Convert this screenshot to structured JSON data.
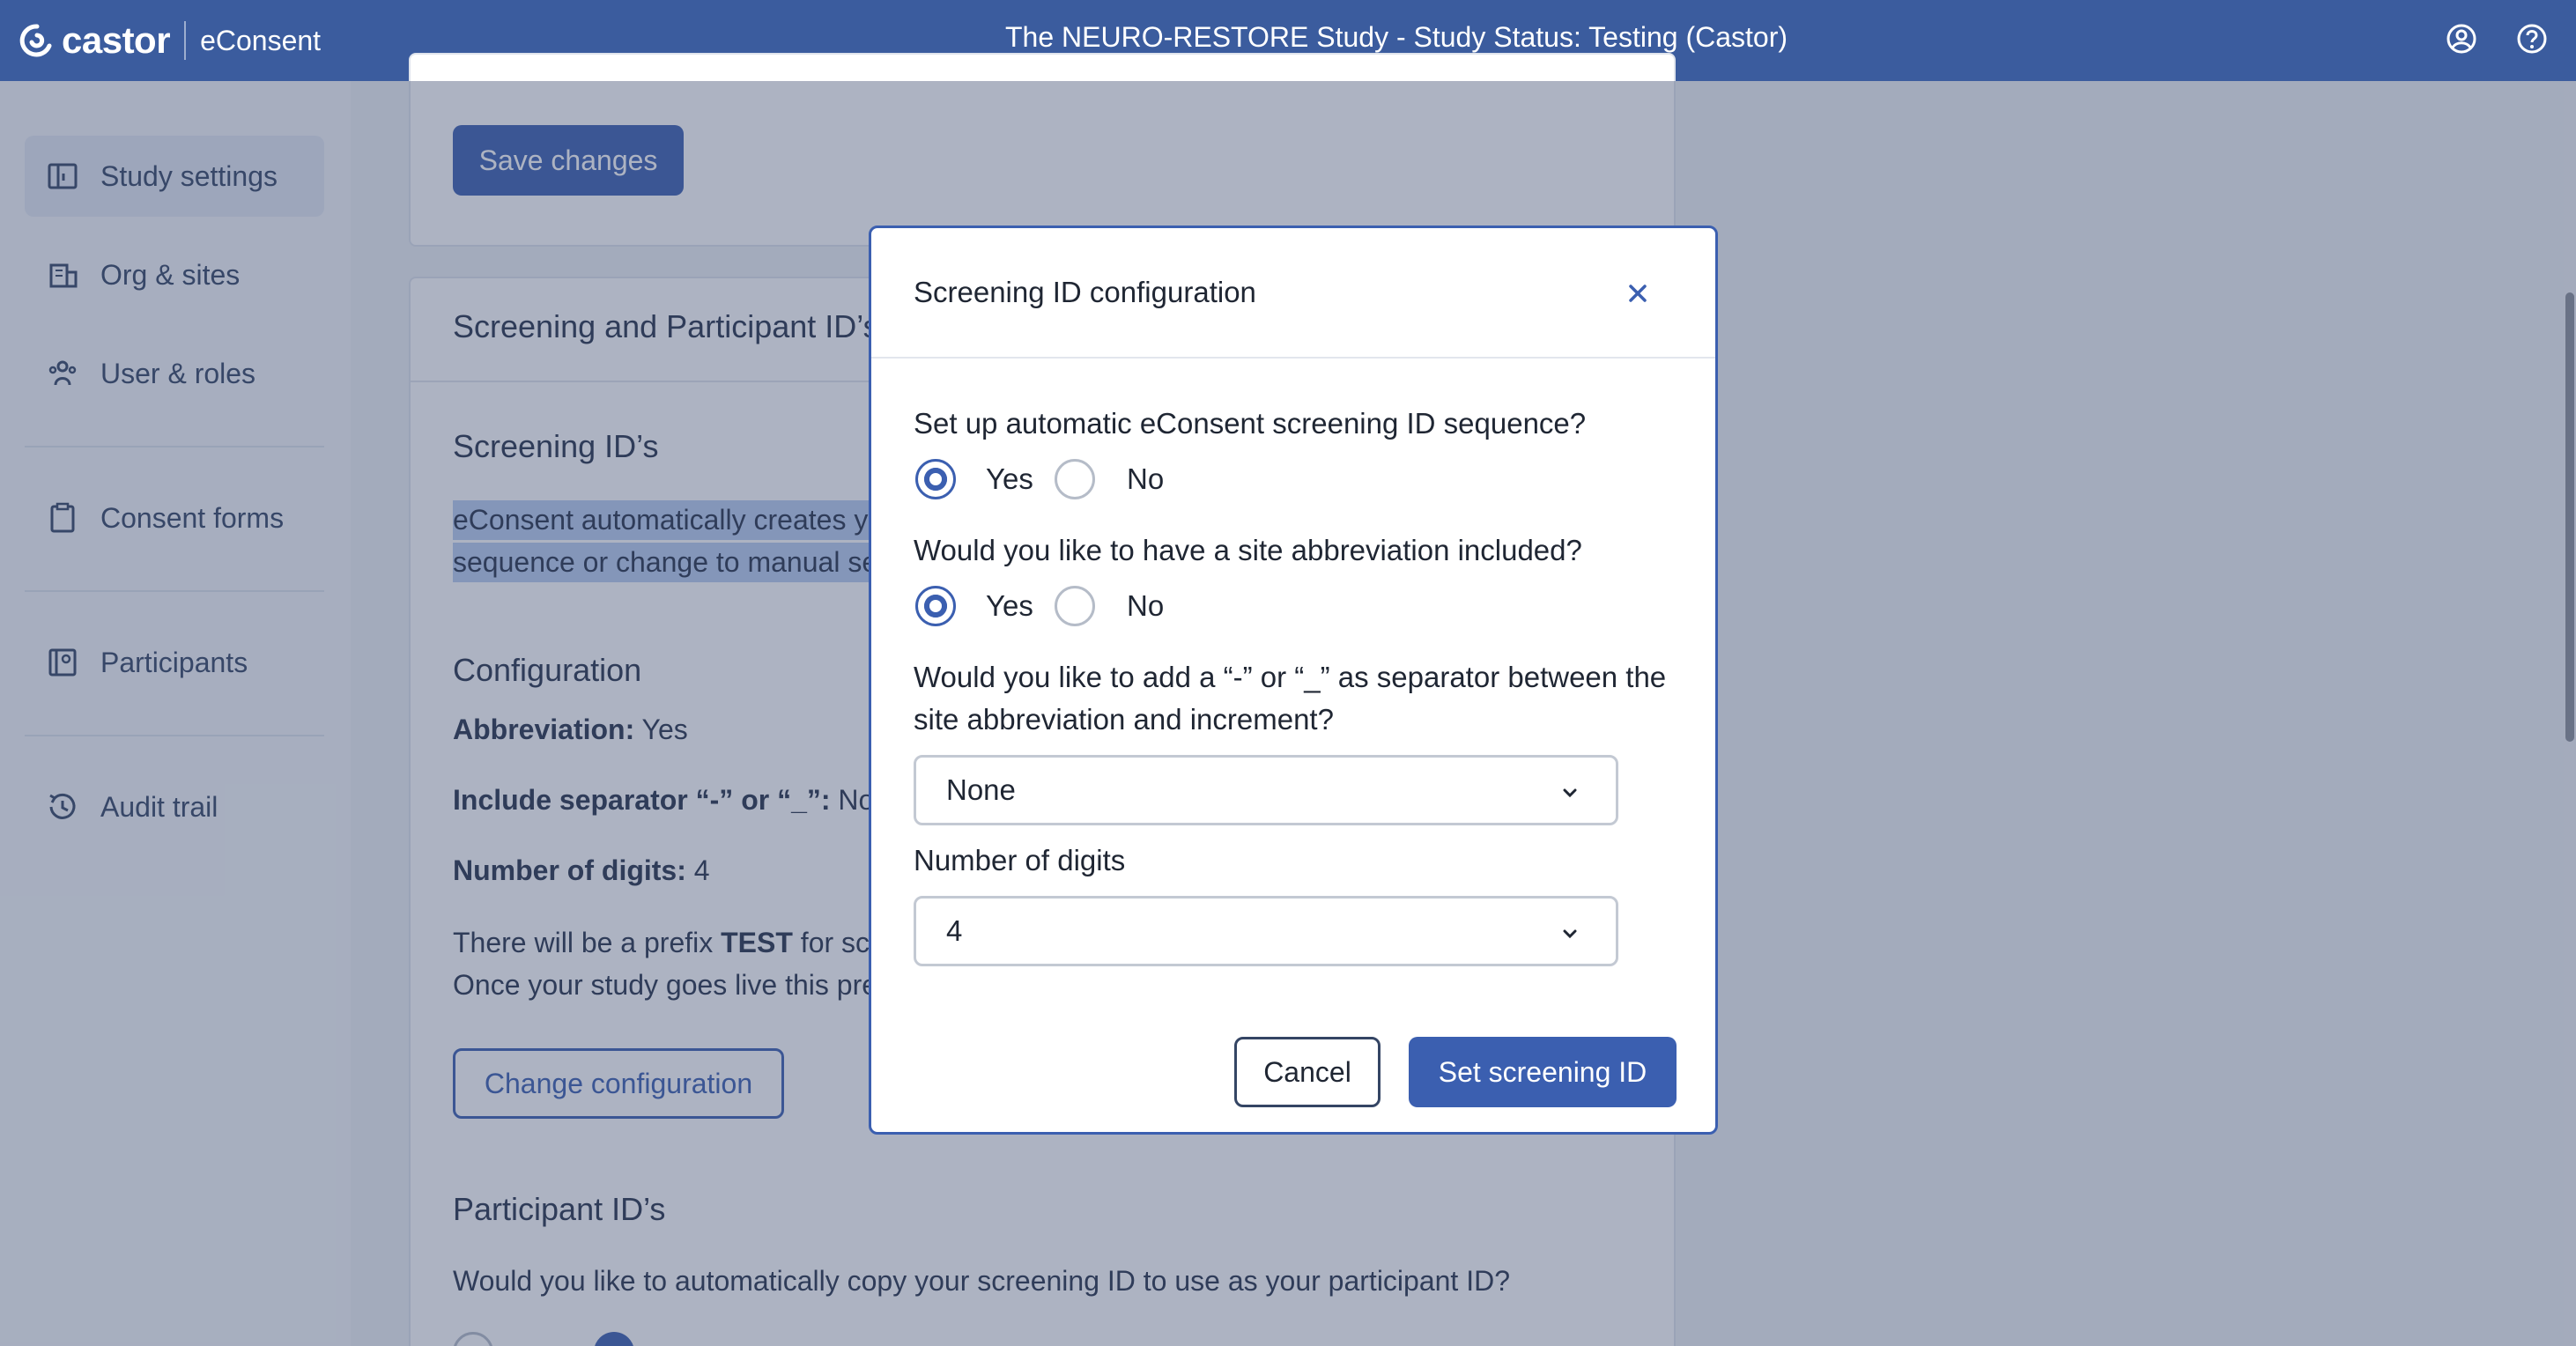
{
  "header": {
    "brand": "castor",
    "product": "eConsent",
    "title": "The NEURO-RESTORE Study  - Study Status: Testing (Castor)",
    "icons": [
      "user-circle-icon",
      "help-circle-icon"
    ]
  },
  "sidebar": {
    "items": [
      {
        "label": "Study settings",
        "icon": "study-settings-icon",
        "active": true
      },
      {
        "label": "Org & sites",
        "icon": "building-icon"
      },
      {
        "label": "User & roles",
        "icon": "users-icon"
      },
      {
        "label": "Consent forms",
        "icon": "clipboard-icon"
      },
      {
        "label": "Participants",
        "icon": "id-card-icon"
      },
      {
        "label": "Audit trail",
        "icon": "history-icon"
      }
    ]
  },
  "main": {
    "save_label": "Save changes",
    "section_title": "Screening and Participant ID’s",
    "screening": {
      "heading": "Screening ID’s",
      "desc_line1": "eConsent automatically creates yo",
      "desc_line2": "sequence or change to manual set",
      "config_heading": "Configuration",
      "abbrev_label": "Abbreviation:",
      "abbrev_value": " Yes",
      "sep_label": "Include separator “-” or “_”:",
      "sep_value": " None",
      "digits_label": "Number of digits:",
      "digits_value": " 4",
      "prefix_pre": "There will be a prefix ",
      "prefix_bold": "TEST",
      "prefix_post": " for scr",
      "live_line": "Once your study goes live this pre",
      "change_label": "Change configuration"
    },
    "participant": {
      "heading": "Participant ID’s",
      "question": "Would you like to automatically copy your screening ID to use as your participant ID?"
    }
  },
  "modal": {
    "title": "Screening ID configuration",
    "q1": "Set up automatic eConsent screening ID sequence?",
    "q1_options": [
      "Yes",
      "No"
    ],
    "q1_selected": "Yes",
    "q2": "Would you like to have a site abbreviation included?",
    "q2_options": [
      "Yes",
      "No"
    ],
    "q2_selected": "Yes",
    "q3_line1": "Would you like to add a “-” or “_” as separator between the",
    "q3_line2": "site abbreviation and increment?",
    "separator_value": "None",
    "digits_label": "Number of digits",
    "digits_value": "4",
    "cancel_label": "Cancel",
    "submit_label": "Set screening ID"
  },
  "colors": {
    "header_bg": "#3b5c9e",
    "primary": "#3b5fb0",
    "highlight": "#b8cdf0"
  }
}
